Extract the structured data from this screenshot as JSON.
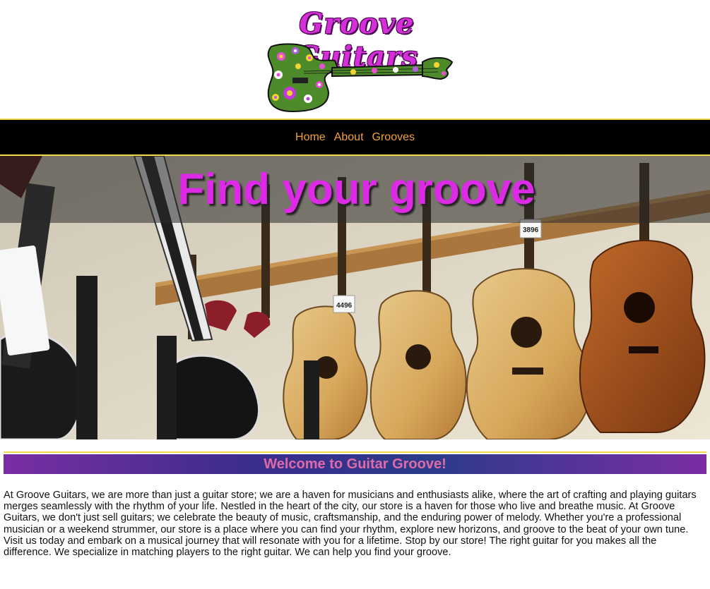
{
  "header": {
    "logo_text": "Groove Guitars"
  },
  "nav": {
    "items": [
      {
        "label": "Home"
      },
      {
        "label": "About"
      },
      {
        "label": "Grooves"
      }
    ]
  },
  "hero": {
    "title": "Find your groove",
    "tag_price_1": "3896",
    "tag_price_2": "4496"
  },
  "welcome": {
    "heading": "Welcome to Guitar Groove!"
  },
  "intro": {
    "paragraph": "At Groove Guitars, we are more than just a guitar store; we are a haven for musicians and enthusiasts alike, where the art of crafting and playing guitars merges seamlessly with the rhythm of your life. Nestled in the heart of the city, our store is a haven for those who live and breathe music. At Groove Guitars, we don't just sell guitars; we celebrate the beauty of music, craftsmanship, and the enduring power of melody. Whether you're a professional musician or a weekend strummer, our store is a place where you can find your rhythm, explore new horizons, and groove to the beat of your own tune. Visit us today and embark on a musical journey that will resonate with you for a lifetime. Stop by our store! The right guitar for you makes all the difference. We specialize in matching players to the right guitar. We can help you find your groove."
  },
  "colors": {
    "accent_pink": "#dd2ae6",
    "nav_link": "#f2a23a",
    "nav_border": "#f2d84b",
    "welcome_text": "#e06aa8"
  }
}
